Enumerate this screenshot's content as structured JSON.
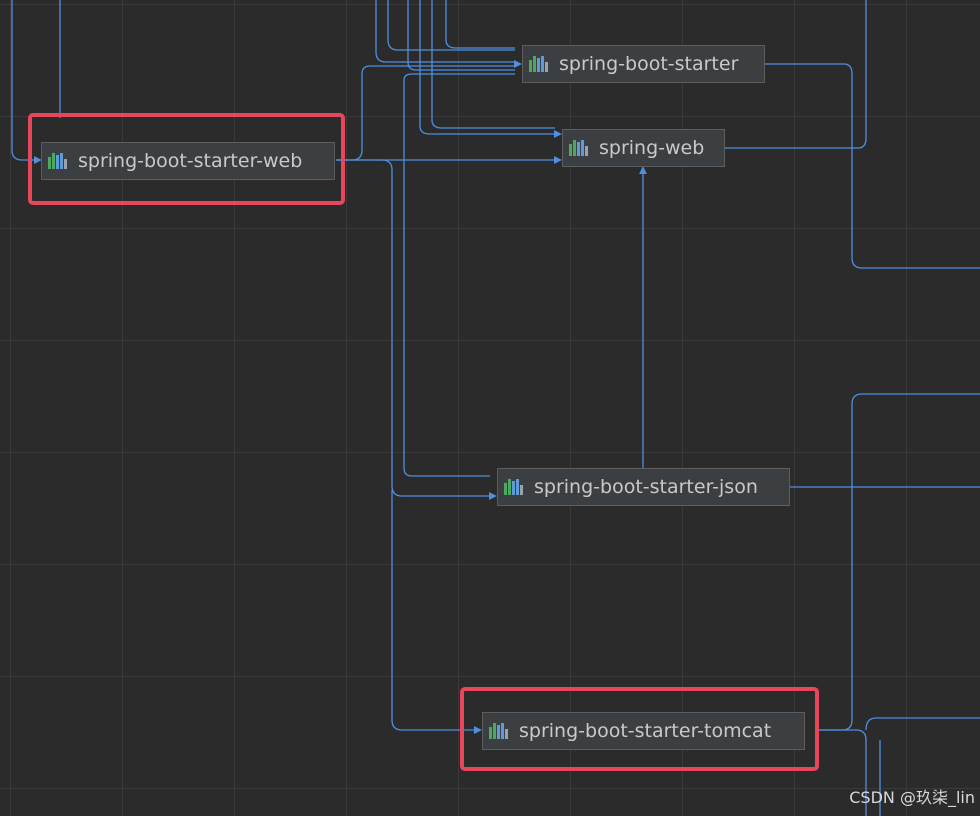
{
  "diagram": {
    "nodes": [
      {
        "id": "spring-boot-starter-web",
        "label": "spring-boot-starter-web",
        "highlighted": true
      },
      {
        "id": "spring-boot-starter",
        "label": "spring-boot-starter",
        "highlighted": false
      },
      {
        "id": "spring-web",
        "label": "spring-web",
        "highlighted": false
      },
      {
        "id": "spring-boot-starter-json",
        "label": "spring-boot-starter-json",
        "highlighted": false
      },
      {
        "id": "spring-boot-starter-tomcat",
        "label": "spring-boot-starter-tomcat",
        "highlighted": true
      }
    ],
    "edges": [
      {
        "from": "spring-boot-starter-web",
        "to": "spring-boot-starter"
      },
      {
        "from": "spring-boot-starter-web",
        "to": "spring-web"
      },
      {
        "from": "spring-boot-starter-web",
        "to": "spring-boot-starter-json"
      },
      {
        "from": "spring-boot-starter-web",
        "to": "spring-boot-starter-tomcat"
      },
      {
        "from": "spring-boot-starter-json",
        "to": "spring-web"
      },
      {
        "from": "spring-boot-starter-json",
        "to": "spring-boot-starter"
      }
    ],
    "colors": {
      "edge": "#4e8fe0",
      "highlight": "#e8475b",
      "node_bg": "#3c3f41"
    },
    "icon": "maven-library-icon"
  },
  "watermark": "CSDN @玖柒_lin"
}
